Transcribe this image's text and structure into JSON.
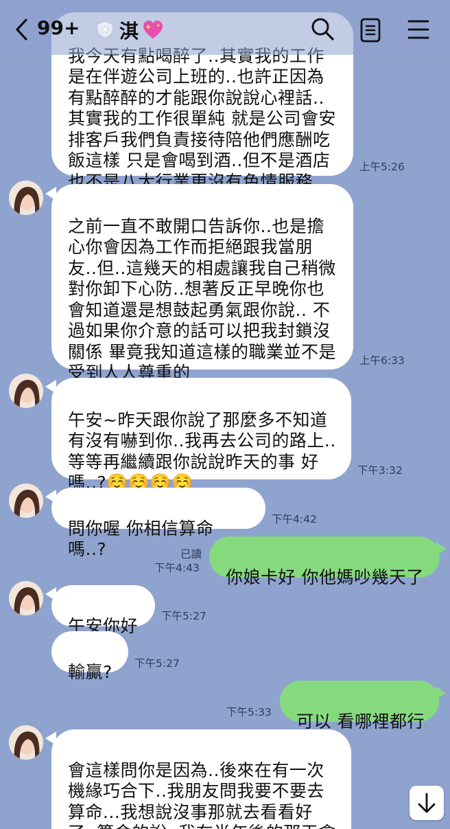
{
  "header": {
    "unread_count": "99+",
    "chat_name": "淇"
  },
  "messages": [
    {
      "direction": "in",
      "text": "我今天有點喝醉了..其實我的工作\n是在伴遊公司上班的..也許正因為\n有點醉醉的才能跟你說說心裡話..\n其實我的工作很單純 就是公司會安\n排客戶我們負責接待陪他們應酬吃\n飯這樣 只是會喝到酒..但不是酒店\n也不是八大行業更沒有色情服務",
      "time": "上午5:26"
    },
    {
      "direction": "in",
      "text": "之前一直不敢開口告訴你..也是擔\n心你會因為工作而拒絕跟我當朋\n友..但..這幾天的相處讓我自己稍微\n對你卸下心防..想著反正早晚你也\n會知道還是想鼓起勇氣跟你說.. 不\n過如果你介意的話可以把我封鎖沒\n關係 畢竟我知道這樣的職業並不是\n受到人人尊重的",
      "time": "上午6:33"
    },
    {
      "direction": "in",
      "text": "午安~昨天跟你說了那麼多不知道\n有沒有嚇到你..我再去公司的路上..\n等等再繼續跟你說說昨天的事 好\n嗎..?☺️☺️☺️☺️",
      "time": "下午3:32"
    },
    {
      "direction": "in",
      "text": "問你喔 你相信算命嗎..?",
      "time": "下午4:42"
    },
    {
      "direction": "out",
      "text": "你娘卡好 你他媽吵幾天了",
      "read": "已讀",
      "time": "下午4:43"
    },
    {
      "direction": "in",
      "text": "午安你好",
      "time": "下午5:27"
    },
    {
      "direction": "in",
      "text": "輸贏?",
      "time": "下午5:27"
    },
    {
      "direction": "out",
      "text": "可以 看哪裡都行",
      "time": "下午5:33"
    },
    {
      "direction": "in",
      "text": "會這樣問你是因為..後來在有一次\n機緣巧合下..我朋友問我要不要去\n算命...我想說沒事那就去看看好\n了..算命的說..我在半年後的那天會\n有新的緣分 會改變我的命運 這",
      "time": ""
    }
  ],
  "colors": {
    "background": "#8fa3cf",
    "incoming_bubble": "#ffffff",
    "outgoing_bubble": "#86da7e"
  },
  "icons": [
    "chevron-left-icon",
    "shield-badge-icon",
    "sparkle-heart-icon",
    "search-icon",
    "notes-icon",
    "menu-icon",
    "arrow-down-icon"
  ]
}
